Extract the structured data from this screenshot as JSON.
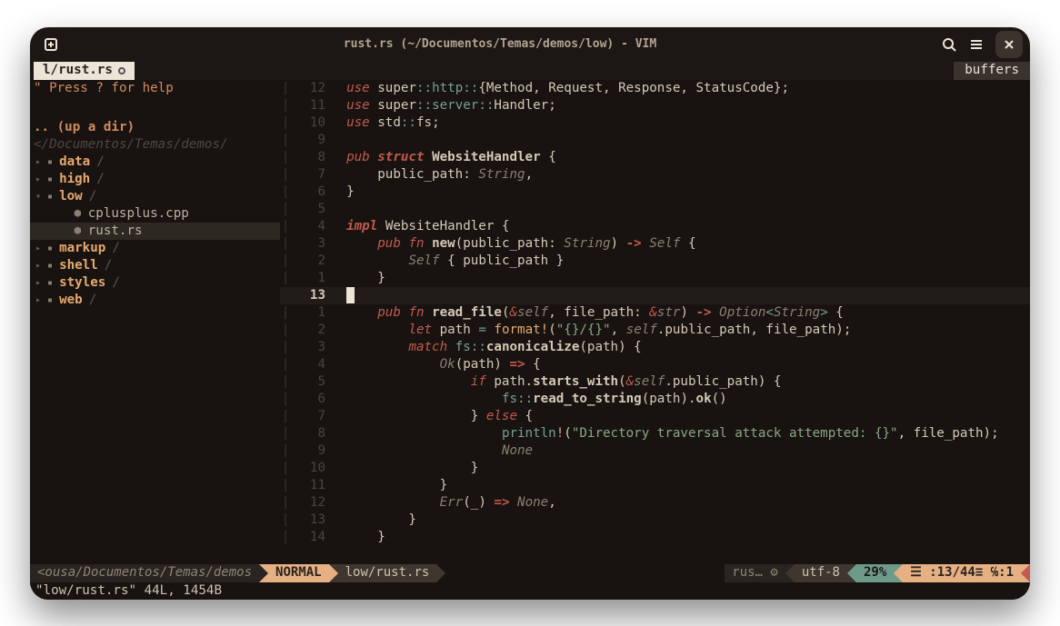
{
  "titlebar": {
    "title": "rust.rs (~/Documentos/Temas/demos/low) - VIM"
  },
  "tabs": {
    "current": "l/rust.rs",
    "buffers_label": "buffers"
  },
  "sidebar": {
    "help": "\" Press ? for help",
    "updir": ".. (up a dir)",
    "cwd": "</Documentos/Temas/demos/",
    "items": [
      {
        "kind": "folder",
        "label": "data",
        "open": false,
        "depth": 0
      },
      {
        "kind": "folder",
        "label": "high",
        "open": false,
        "depth": 0
      },
      {
        "kind": "folder",
        "label": "low",
        "open": true,
        "depth": 0
      },
      {
        "kind": "file",
        "label": "cplusplus.cpp",
        "depth": 1
      },
      {
        "kind": "file",
        "label": "rust.rs",
        "depth": 1,
        "selected": true
      },
      {
        "kind": "folder",
        "label": "markup",
        "open": false,
        "depth": 0
      },
      {
        "kind": "folder",
        "label": "shell",
        "open": false,
        "depth": 0
      },
      {
        "kind": "folder",
        "label": "styles",
        "open": false,
        "depth": 0
      },
      {
        "kind": "folder",
        "label": "web",
        "open": false,
        "depth": 0
      }
    ]
  },
  "code": {
    "current_rel": "13",
    "lines": [
      {
        "rel": "12",
        "tokens": [
          [
            "kw",
            "use "
          ],
          [
            "ident",
            "super"
          ],
          [
            "op-colon",
            "::"
          ],
          [
            "green",
            "http"
          ],
          [
            "op-colon",
            "::"
          ],
          [
            "ident",
            "{Method, Request, Response, StatusCode};"
          ]
        ]
      },
      {
        "rel": "11",
        "tokens": [
          [
            "kw",
            "use "
          ],
          [
            "ident",
            "super"
          ],
          [
            "op-colon",
            "::"
          ],
          [
            "green",
            "server"
          ],
          [
            "op-colon",
            "::"
          ],
          [
            "ident",
            "Handler;"
          ]
        ]
      },
      {
        "rel": "10",
        "tokens": [
          [
            "kw",
            "use "
          ],
          [
            "ident",
            "std"
          ],
          [
            "op-colon",
            "::"
          ],
          [
            "ident",
            "fs;"
          ]
        ]
      },
      {
        "rel": "9",
        "tokens": []
      },
      {
        "rel": "8",
        "tokens": [
          [
            "kw",
            "pub "
          ],
          [
            "kw2",
            "struct "
          ],
          [
            "struct-name",
            "WebsiteHandler"
          ],
          [
            "ident",
            " {"
          ]
        ]
      },
      {
        "rel": "7",
        "tokens": [
          [
            "ident",
            "    public_path: "
          ],
          [
            "type",
            "String"
          ],
          [
            "ident",
            ","
          ]
        ]
      },
      {
        "rel": "6",
        "tokens": [
          [
            "ident",
            "}"
          ]
        ]
      },
      {
        "rel": "5",
        "tokens": []
      },
      {
        "rel": "4",
        "tokens": [
          [
            "kw2",
            "impl "
          ],
          [
            "ident",
            "WebsiteHandler {"
          ]
        ]
      },
      {
        "rel": "3",
        "tokens": [
          [
            "ident",
            "    "
          ],
          [
            "kw",
            "pub "
          ],
          [
            "kw",
            "fn "
          ],
          [
            "fn-name",
            "new"
          ],
          [
            "paren",
            "("
          ],
          [
            "ident",
            "public_path: "
          ],
          [
            "type",
            "String"
          ],
          [
            "paren",
            ")"
          ],
          [
            "ident",
            " "
          ],
          [
            "op-arrow",
            "->"
          ],
          [
            "ident",
            " "
          ],
          [
            "type",
            "Self"
          ],
          [
            "ident",
            " {"
          ]
        ]
      },
      {
        "rel": "2",
        "tokens": [
          [
            "ident",
            "        "
          ],
          [
            "type",
            "Self"
          ],
          [
            "ident",
            " { public_path }"
          ]
        ]
      },
      {
        "rel": "1",
        "tokens": [
          [
            "ident",
            "    }"
          ]
        ]
      },
      {
        "rel": "13",
        "current": true,
        "tokens": []
      },
      {
        "rel": "1",
        "tokens": [
          [
            "ident",
            "    "
          ],
          [
            "kw",
            "pub "
          ],
          [
            "kw",
            "fn "
          ],
          [
            "fn-name",
            "read_file"
          ],
          [
            "paren",
            "("
          ],
          [
            "amp",
            "&"
          ],
          [
            "type-self",
            "self"
          ],
          [
            "ident",
            ", file_path: "
          ],
          [
            "amp",
            "&"
          ],
          [
            "type",
            "str"
          ],
          [
            "paren",
            ")"
          ],
          [
            "ident",
            " "
          ],
          [
            "op-arrow",
            "->"
          ],
          [
            "ident",
            " "
          ],
          [
            "type",
            "Option"
          ],
          [
            "green",
            "<"
          ],
          [
            "type",
            "String"
          ],
          [
            "green",
            ">"
          ],
          [
            "ident",
            " {"
          ]
        ]
      },
      {
        "rel": "2",
        "tokens": [
          [
            "ident",
            "        "
          ],
          [
            "kw",
            "let "
          ],
          [
            "ident",
            "path "
          ],
          [
            "green",
            "= "
          ],
          [
            "macro",
            "format!"
          ],
          [
            "paren",
            "("
          ],
          [
            "string",
            "\"{}/{}\""
          ],
          [
            "ident",
            ", "
          ],
          [
            "type-self",
            "self"
          ],
          [
            "ident",
            ".public_path, file_path);"
          ]
        ]
      },
      {
        "rel": "3",
        "tokens": [
          [
            "ident",
            "        "
          ],
          [
            "kw",
            "match "
          ],
          [
            "green",
            "fs"
          ],
          [
            "op-colon",
            "::"
          ],
          [
            "fn-name",
            "canonicalize"
          ],
          [
            "paren",
            "("
          ],
          [
            "ident",
            "path"
          ],
          [
            "paren",
            ")"
          ],
          [
            "ident",
            " {"
          ]
        ]
      },
      {
        "rel": "4",
        "tokens": [
          [
            "ident",
            "            "
          ],
          [
            "type",
            "Ok"
          ],
          [
            "paren",
            "("
          ],
          [
            "ident",
            "path"
          ],
          [
            "paren",
            ")"
          ],
          [
            "ident",
            " "
          ],
          [
            "op-arrow",
            "=>"
          ],
          [
            "ident",
            " {"
          ]
        ]
      },
      {
        "rel": "5",
        "tokens": [
          [
            "ident",
            "                "
          ],
          [
            "kw",
            "if "
          ],
          [
            "ident",
            "path."
          ],
          [
            "fn-name",
            "starts_with"
          ],
          [
            "paren",
            "("
          ],
          [
            "amp",
            "&"
          ],
          [
            "type-self",
            "self"
          ],
          [
            "ident",
            ".public_path"
          ],
          [
            "paren",
            ")"
          ],
          [
            "ident",
            " {"
          ]
        ]
      },
      {
        "rel": "6",
        "tokens": [
          [
            "ident",
            "                    "
          ],
          [
            "green",
            "fs"
          ],
          [
            "op-colon",
            "::"
          ],
          [
            "fn-name",
            "read_to_string"
          ],
          [
            "paren",
            "("
          ],
          [
            "ident",
            "path"
          ],
          [
            "paren",
            ")"
          ],
          [
            "ident",
            "."
          ],
          [
            "fn-name",
            "ok"
          ],
          [
            "paren",
            "()"
          ]
        ]
      },
      {
        "rel": "7",
        "tokens": [
          [
            "ident",
            "                } "
          ],
          [
            "kw",
            "else"
          ],
          [
            "ident",
            " {"
          ]
        ]
      },
      {
        "rel": "8",
        "tokens": [
          [
            "ident",
            "                    "
          ],
          [
            "green",
            "println"
          ],
          [
            "macro",
            "!"
          ],
          [
            "paren",
            "("
          ],
          [
            "string",
            "\"Directory traversal attack attempted: {}\""
          ],
          [
            "ident",
            ", file_path);"
          ]
        ]
      },
      {
        "rel": "9",
        "tokens": [
          [
            "ident",
            "                    "
          ],
          [
            "type",
            "None"
          ]
        ]
      },
      {
        "rel": "10",
        "tokens": [
          [
            "ident",
            "                }"
          ]
        ]
      },
      {
        "rel": "11",
        "tokens": [
          [
            "ident",
            "            }"
          ]
        ]
      },
      {
        "rel": "12",
        "tokens": [
          [
            "ident",
            "            "
          ],
          [
            "type",
            "Err"
          ],
          [
            "paren",
            "("
          ],
          [
            "ident",
            "_"
          ],
          [
            "paren",
            ")"
          ],
          [
            "ident",
            " "
          ],
          [
            "op-arrow",
            "=>"
          ],
          [
            "ident",
            " "
          ],
          [
            "type",
            "None"
          ],
          [
            "ident",
            ","
          ]
        ]
      },
      {
        "rel": "13",
        "tokens": [
          [
            "ident",
            "        }"
          ]
        ]
      },
      {
        "rel": "14",
        "tokens": [
          [
            "ident",
            "    }"
          ]
        ]
      }
    ]
  },
  "status": {
    "path": "<ousa/Documentos/Temas/demos",
    "mode": "NORMAL",
    "file": "low/rust.rs",
    "filetype": "rus… ⚙",
    "encoding": "utf-8 ",
    "percent": "29%",
    "position": "☰ :13/44≡ ℅:1"
  },
  "cmdline": "\"low/rust.rs\" 44L, 1454B"
}
